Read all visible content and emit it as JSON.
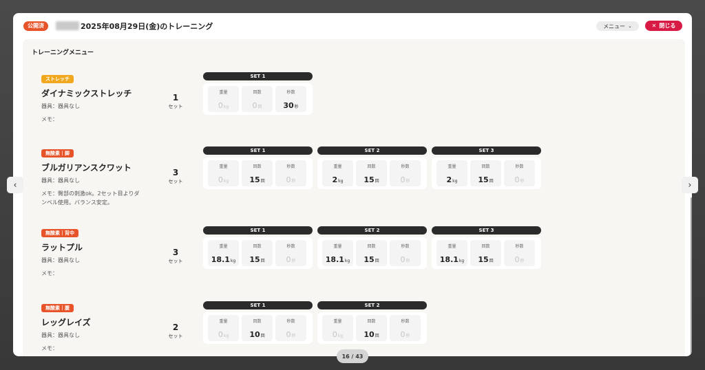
{
  "header": {
    "status_badge": "公開済",
    "title": "2025年08月29日(金)のトレーニング",
    "menu_label": "メニュー",
    "close_label": "閉じる"
  },
  "section_title": "トレーニングメニュー",
  "labels": {
    "weight": "重量",
    "reps": "回数",
    "seconds": "秒数",
    "set_unit": "セット"
  },
  "units": {
    "kg": "kg",
    "reps": "回",
    "sec": "秒"
  },
  "colors": {
    "stretch": "#f2a81d",
    "anaerobic": "#e8542a",
    "close": "#d81b45"
  },
  "exercises": [
    {
      "category": "ストレッチ",
      "name": "ダイナミックストレッチ",
      "equipment": "器具：器具なし",
      "memo": "メモ：",
      "set_count": "1",
      "sets": [
        {
          "label": "SET 1",
          "weight": "0",
          "reps": "0",
          "seconds": "30"
        }
      ]
    },
    {
      "category": "無酸素｜脚",
      "name": "ブルガリアンスクワット",
      "equipment": "器具：器具なし",
      "memo": "メモ：臀部の刺激ok。2セット目よりダンベル使用。バランス安定。",
      "set_count": "3",
      "sets": [
        {
          "label": "SET 1",
          "weight": "0",
          "reps": "15",
          "seconds": "0"
        },
        {
          "label": "SET 2",
          "weight": "2",
          "reps": "15",
          "seconds": "0"
        },
        {
          "label": "SET 3",
          "weight": "2",
          "reps": "15",
          "seconds": "0"
        }
      ]
    },
    {
      "category": "無酸素｜背中",
      "name": "ラットプル",
      "equipment": "器具：器具なし",
      "memo": "メモ：",
      "set_count": "3",
      "sets": [
        {
          "label": "SET 1",
          "weight": "18.1",
          "reps": "15",
          "seconds": "0"
        },
        {
          "label": "SET 2",
          "weight": "18.1",
          "reps": "15",
          "seconds": "0"
        },
        {
          "label": "SET 3",
          "weight": "18.1",
          "reps": "15",
          "seconds": "0"
        }
      ]
    },
    {
      "category": "無酸素｜腹",
      "name": "レッグレイズ",
      "equipment": "器具：器具なし",
      "memo": "メモ：",
      "set_count": "2",
      "sets": [
        {
          "label": "SET 1",
          "weight": "0",
          "reps": "10",
          "seconds": "0"
        },
        {
          "label": "SET 2",
          "weight": "0",
          "reps": "10",
          "seconds": "0"
        }
      ]
    }
  ],
  "pagination": "16 / 43",
  "icons": {
    "prev": "chevron-left-icon",
    "next": "chevron-right-icon",
    "close": "close-icon",
    "menu": "chevron-down-icon"
  }
}
